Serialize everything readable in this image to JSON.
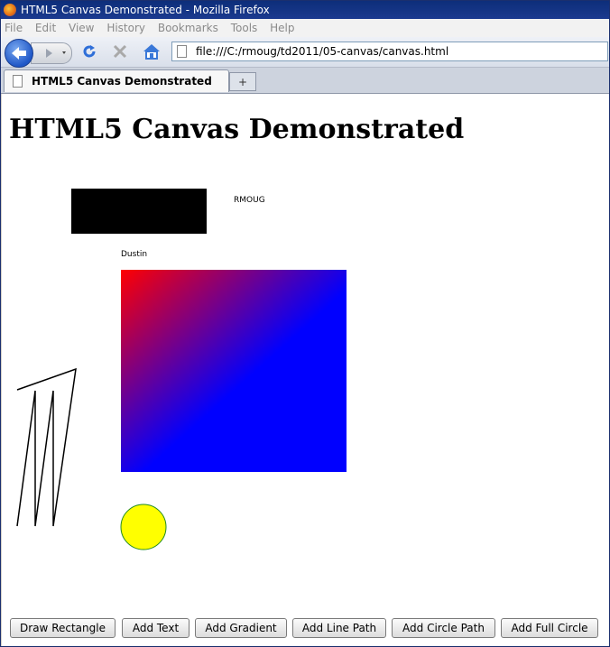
{
  "window": {
    "title": "HTML5 Canvas Demonstrated - Mozilla Firefox"
  },
  "menu": [
    "File",
    "Edit",
    "View",
    "History",
    "Bookmarks",
    "Tools",
    "Help"
  ],
  "toolbar": {
    "url": "file:///C:/rmoug/td2011/05-canvas/canvas.html",
    "back_icon": "back-arrow-icon",
    "forward_icon": "forward-arrow-icon",
    "reload_icon": "reload-icon",
    "stop_icon": "stop-icon",
    "home_icon": "home-icon"
  },
  "tab": {
    "label": "HTML5 Canvas Demonstrated",
    "new_tab_symbol": "+"
  },
  "page": {
    "heading": "HTML5 Canvas Demonstrated",
    "canvas": {
      "text_rmoug": "RMOUG",
      "text_dustin": "Dustin",
      "rect_fill": "#000000",
      "gradient_from": "#ff0000",
      "gradient_to": "#0000ff",
      "circle_fill": "#ffff00",
      "circle_stroke": "#228b22",
      "path_stroke": "#000000"
    },
    "buttons": [
      "Draw Rectangle",
      "Add Text",
      "Add Gradient",
      "Add Line Path",
      "Add Circle Path",
      "Add Full Circle"
    ]
  }
}
